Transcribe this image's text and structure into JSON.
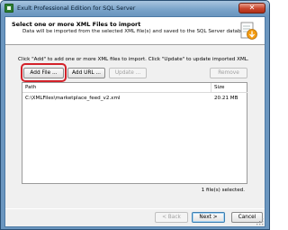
{
  "window": {
    "title": "Exult Professional Edition for SQL Server",
    "close_glyph": "✕"
  },
  "header": {
    "title": "Select one or more XML Files to import",
    "subtitle": "Data will be imported from the selected XML file(s) and saved to the SQL Server database."
  },
  "instructions": "Click \"Add\" to add one or more XML files to import. Click \"Update\" to update imported XML.",
  "toolbar": {
    "add_file": "Add File ...",
    "add_url": "Add URL ...",
    "update": "Update ...",
    "remove": "Remove"
  },
  "file_list": {
    "columns": {
      "path": "Path",
      "size": "Size"
    },
    "rows": [
      {
        "path": "C:\\XMLFiles\\marketplace_feed_v2.xml",
        "size": "20.21 MB"
      }
    ]
  },
  "status": "1 file(s) selected.",
  "nav": {
    "back": "< Back",
    "next": "Next >",
    "cancel": "Cancel"
  },
  "icons": {
    "app": "app-logo-icon",
    "header": "import-document-icon",
    "close": "close-icon",
    "grip": "resize-grip-icon"
  },
  "colors": {
    "highlight_ring": "#d3222a",
    "titlebar": "#7aa3c9"
  }
}
